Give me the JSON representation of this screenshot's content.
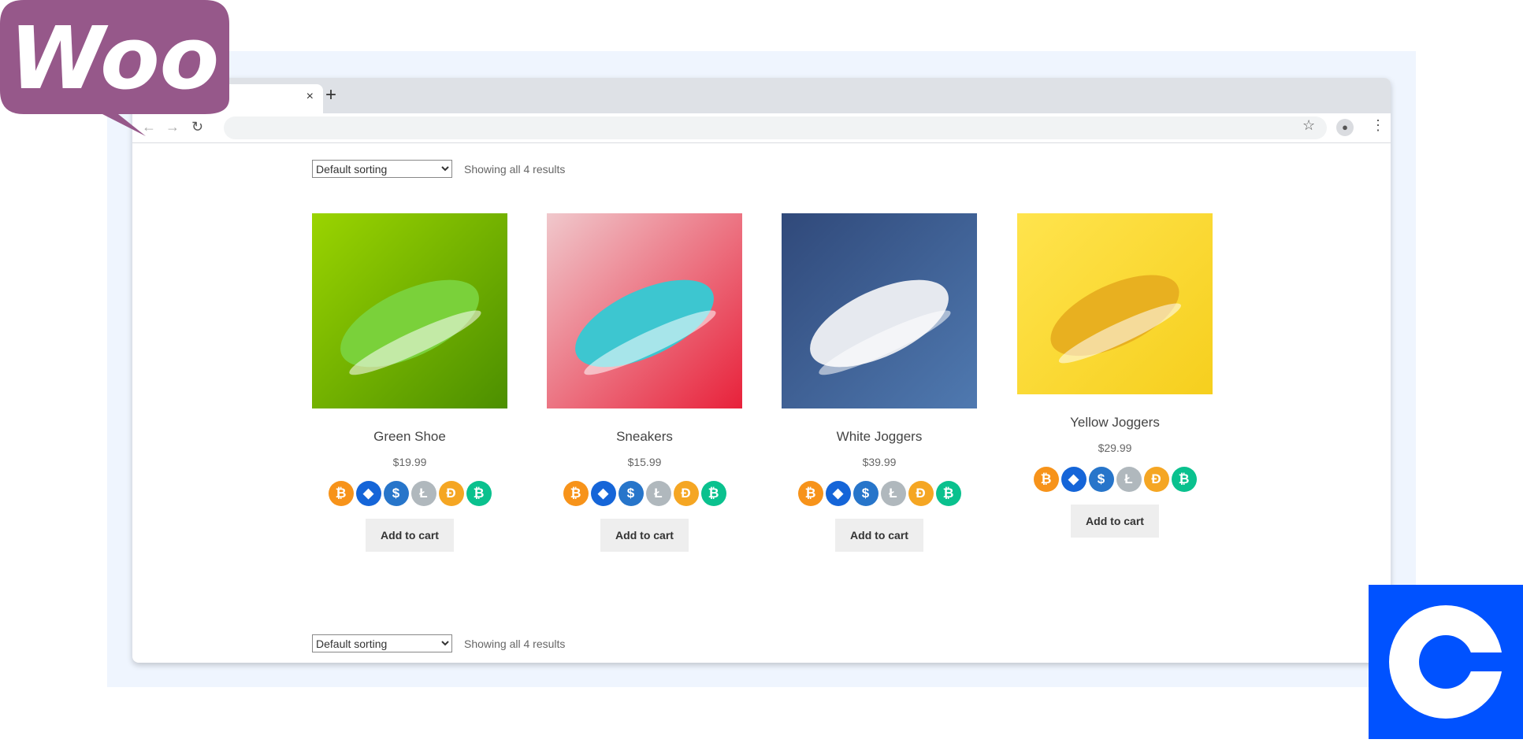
{
  "browser": {
    "close_tab": "×",
    "new_tab": "+",
    "back": "←",
    "forward": "→",
    "reload": "↻",
    "star": "☆",
    "menu": "⋮"
  },
  "shop": {
    "sort_label": "Default sorting",
    "result_count": "Showing all 4 results",
    "products": [
      {
        "name": "Green Shoe",
        "price": "$19.99",
        "bg": [
          "#9ad400",
          "#4c8f00"
        ],
        "shoe": "#7ad13a",
        "button": "Add to cart"
      },
      {
        "name": "Sneakers",
        "price": "$15.99",
        "bg": [
          "#f0c8cc",
          "#e8213a"
        ],
        "shoe": "#3dc6d0",
        "button": "Add to cart"
      },
      {
        "name": "White Joggers",
        "price": "$39.99",
        "bg": [
          "#30497a",
          "#4f79b0"
        ],
        "shoe": "#e6e9ef",
        "button": "Add to cart"
      },
      {
        "name": "Yellow Joggers",
        "price": "$29.99",
        "bg": [
          "#ffe44d",
          "#f6cf1e"
        ],
        "shoe": "#e8b020",
        "button": "Add to cart"
      }
    ],
    "coins": [
      {
        "name": "bitcoin",
        "glyph": "₿",
        "color": "#f7931a"
      },
      {
        "name": "ethereum",
        "glyph": "◆",
        "color": "#1565d8"
      },
      {
        "name": "usdc",
        "glyph": "$",
        "color": "#2775ca"
      },
      {
        "name": "litecoin",
        "glyph": "Ł",
        "color": "#b0b8bd"
      },
      {
        "name": "dai",
        "glyph": "Ð",
        "color": "#f5a623"
      },
      {
        "name": "bitcoin-cash",
        "glyph": "₿",
        "color": "#0ac18e"
      }
    ]
  },
  "logos": {
    "woo": "Woo",
    "woo_color": "#96588a",
    "coinbase_color": "#0052ff"
  }
}
